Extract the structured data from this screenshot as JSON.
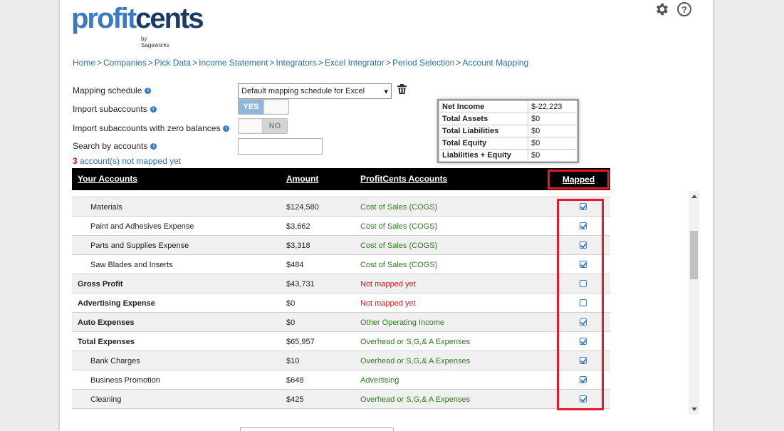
{
  "logo": {
    "part1": "profit",
    "part2": "cents",
    "sub": "by Sageworks"
  },
  "icons": {
    "settings": "gear-icon",
    "help": "help-icon"
  },
  "breadcrumb": [
    "Home",
    "Companies",
    "Pick Data",
    "Income Statement",
    "Integrators",
    "Excel Integrator",
    "Period Selection",
    "Account Mapping"
  ],
  "form": {
    "mapping_schedule_label": "Mapping schedule",
    "mapping_schedule_value": "Default mapping schedule for Excel",
    "import_subaccounts_label": "Import subaccounts",
    "import_subaccounts_value": "YES",
    "import_zero_label": "Import subaccounts with zero balances",
    "import_zero_value": "NO",
    "search_label": "Search by accounts",
    "search_value": "",
    "not_mapped_count": "3",
    "not_mapped_text": " account(s) not mapped yet"
  },
  "summary": [
    {
      "label": "Net Income",
      "value": "$-22,223"
    },
    {
      "label": "Total Assets",
      "value": "$0"
    },
    {
      "label": "Total Liabilities",
      "value": "$0"
    },
    {
      "label": "Total Equity",
      "value": "$0"
    },
    {
      "label": "Liabilities + Equity",
      "value": "$0"
    }
  ],
  "table": {
    "headers": {
      "accounts": "Your Accounts",
      "amount": "Amount",
      "pc": "ProfitCents Accounts",
      "mapped": "Mapped"
    },
    "rows": [
      {
        "name": "Materials",
        "amount": "$124,580",
        "pc": "Cost of Sales (COGS)",
        "mapped": true,
        "sub": true,
        "bold": false,
        "status": "ok"
      },
      {
        "name": "Paint and Adhesives Expense",
        "amount": "$3,662",
        "pc": "Cost of Sales (COGS)",
        "mapped": true,
        "sub": true,
        "bold": false,
        "status": "ok"
      },
      {
        "name": "Parts and Supplies Expense",
        "amount": "$3,318",
        "pc": "Cost of Sales (COGS)",
        "mapped": true,
        "sub": true,
        "bold": false,
        "status": "ok"
      },
      {
        "name": "Saw Blades and Inserts",
        "amount": "$484",
        "pc": "Cost of Sales (COGS)",
        "mapped": true,
        "sub": true,
        "bold": false,
        "status": "ok"
      },
      {
        "name": "Gross Profit",
        "amount": "$43,731",
        "pc": "Not mapped yet",
        "mapped": false,
        "sub": false,
        "bold": true,
        "status": "bad"
      },
      {
        "name": "Advertising Expense",
        "amount": "$0",
        "pc": "Not mapped yet",
        "mapped": false,
        "sub": false,
        "bold": true,
        "status": "bad"
      },
      {
        "name": "Auto Expenses",
        "amount": "$0",
        "pc": "Other Operating Income",
        "mapped": true,
        "sub": false,
        "bold": true,
        "status": "ok"
      },
      {
        "name": "Total Expenses",
        "amount": "$65,957",
        "pc": "Overhead or S,G,& A Expenses",
        "mapped": true,
        "sub": false,
        "bold": true,
        "status": "ok"
      },
      {
        "name": "Bank Charges",
        "amount": "$10",
        "pc": "Overhead or S,G,& A Expenses",
        "mapped": true,
        "sub": true,
        "bold": false,
        "status": "ok"
      },
      {
        "name": "Business Promotion",
        "amount": "$648",
        "pc": "Advertising",
        "mapped": true,
        "sub": true,
        "bold": false,
        "status": "ok"
      },
      {
        "name": "Cleaning",
        "amount": "$425",
        "pc": "Overhead or S,G,& A Expenses",
        "mapped": true,
        "sub": true,
        "bold": false,
        "status": "ok"
      }
    ]
  }
}
